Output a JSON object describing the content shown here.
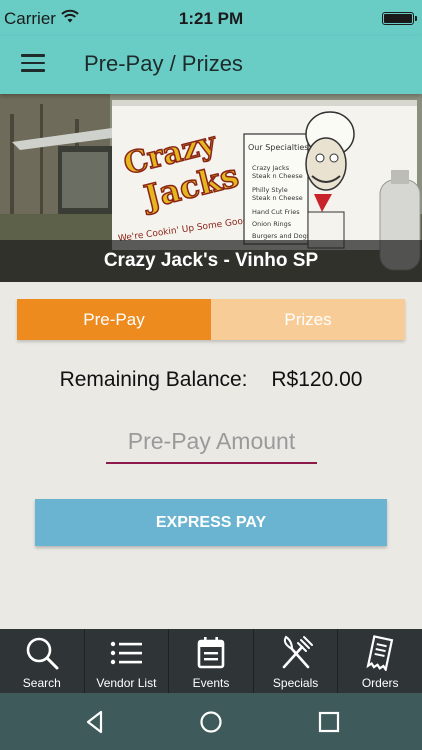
{
  "status_bar": {
    "carrier": "Carrier",
    "time": "1:21 PM"
  },
  "app_bar": {
    "title": "Pre-Pay / Prizes",
    "menu_icon": "hamburger-menu-icon"
  },
  "hero": {
    "caption": "Crazy Jack's - Vinho SP"
  },
  "tabs": [
    {
      "label": "Pre-Pay",
      "active": true
    },
    {
      "label": "Prizes",
      "active": false
    }
  ],
  "balance": {
    "label": "Remaining Balance:",
    "value": "R$120.00"
  },
  "amount": {
    "placeholder": "Pre-Pay Amount",
    "value": ""
  },
  "express_pay": {
    "label": "EXPRESS PAY"
  },
  "bottom_nav": [
    {
      "label": "Search",
      "icon": "search-icon"
    },
    {
      "label": "Vendor List",
      "icon": "list-icon"
    },
    {
      "label": "Events",
      "icon": "calendar-icon"
    },
    {
      "label": "Specials",
      "icon": "fork-knife-icon"
    },
    {
      "label": "Orders",
      "icon": "receipt-icon"
    }
  ],
  "colors": {
    "header": "#69cdc6",
    "tab_active": "#ee8b1e",
    "tab_inactive": "#f7cc96",
    "button": "#6ab3d1",
    "input_underline": "#8c1a4a",
    "bottom_nav": "#2f3537",
    "system_nav": "#3e5a5a"
  }
}
